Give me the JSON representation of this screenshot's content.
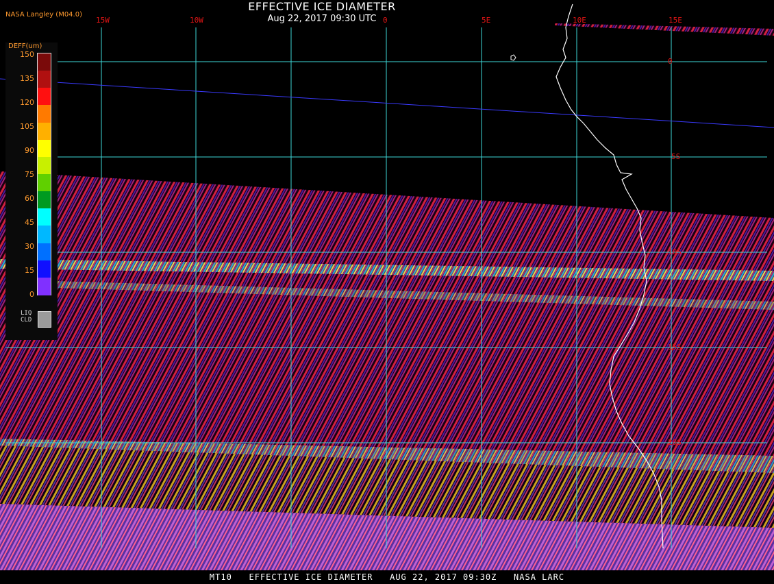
{
  "title": "EFFECTIVE ICE DIAMETER",
  "timestamp": "Aug 22, 2017 09:30 UTC",
  "producer": "NASA Langley (M04.0)",
  "longitude_labels": [
    "15W",
    "10W",
    "0",
    "5E",
    "10E",
    "15E"
  ],
  "latitude_labels": [
    "0",
    "5S",
    "10S",
    "15S",
    "20S"
  ],
  "legend": {
    "title": "DEFF(um)",
    "ticks": [
      "150",
      "135",
      "120",
      "105",
      "90",
      "75",
      "60",
      "45",
      "30",
      "15",
      "0"
    ],
    "colors": [
      "#7a0a0a",
      "#b01010",
      "#ff1010",
      "#ff7a00",
      "#ffb000",
      "#ffff00",
      "#c8f000",
      "#60d000",
      "#009a20",
      "#00ffff",
      "#00b8ff",
      "#0070ff",
      "#1010ff",
      "#8030ff"
    ],
    "liquid_cloud_label": "LIQ\nCLD",
    "liquid_cloud_color": "#9a9a9a"
  },
  "footer": "MT10   EFFECTIVE ICE DIAMETER   AUG 22, 2017 09:30Z   NASA LARC"
}
